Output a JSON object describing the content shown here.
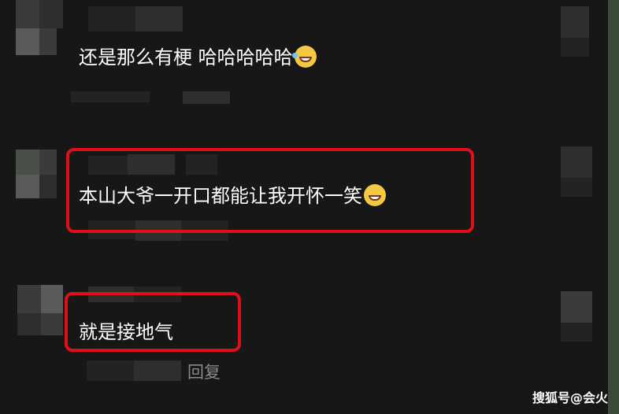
{
  "comments": [
    {
      "text": "还是那么有梗 哈哈哈哈哈",
      "emoji": "rolling-laughing-emoji"
    },
    {
      "text": "本山大爷一开口都能让我开怀一笑",
      "emoji": "grinning-emoji"
    },
    {
      "text": "就是接地气"
    }
  ],
  "reply_label": "回复",
  "watermark": "搜狐号@会火",
  "colors": {
    "highlight": "#e0101a",
    "background": "#171717"
  }
}
